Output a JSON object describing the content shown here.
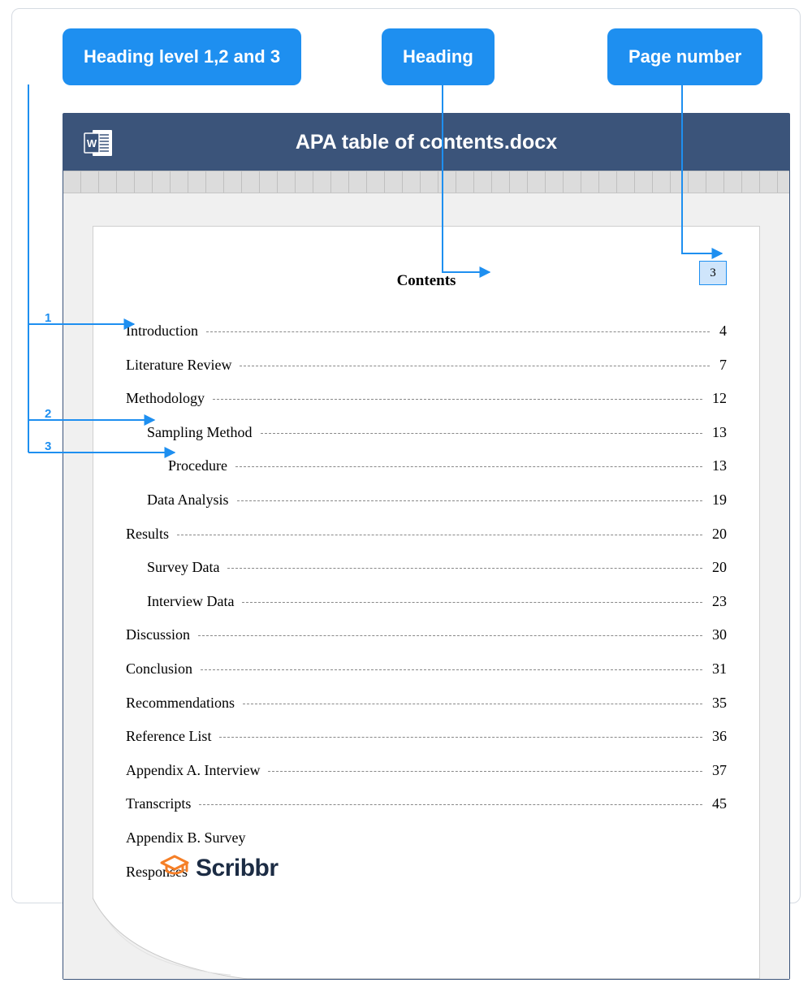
{
  "callouts": {
    "levels": "Heading level 1,2 and 3",
    "heading": "Heading",
    "pagenum": "Page number"
  },
  "levelNums": {
    "n1": "1",
    "n2": "2",
    "n3": "3"
  },
  "window": {
    "title": "APA table of contents.docx"
  },
  "page": {
    "number": "3",
    "contents_title": "Contents"
  },
  "toc": [
    {
      "label": "Introduction",
      "page": "4",
      "level": 1
    },
    {
      "label": "Literature Review",
      "page": "7",
      "level": 1
    },
    {
      "label": "Methodology",
      "page": "12",
      "level": 1
    },
    {
      "label": "Sampling Method",
      "page": "13",
      "level": 2
    },
    {
      "label": "Procedure",
      "page": "13",
      "level": 3
    },
    {
      "label": "Data Analysis",
      "page": "19",
      "level": 2
    },
    {
      "label": "Results",
      "page": "20",
      "level": 1
    },
    {
      "label": "Survey Data",
      "page": "20",
      "level": 2
    },
    {
      "label": "Interview Data",
      "page": "23",
      "level": 2
    },
    {
      "label": "Discussion",
      "page": "30",
      "level": 1
    },
    {
      "label": "Conclusion",
      "page": "31",
      "level": 1
    },
    {
      "label": "Recommendations",
      "page": "35",
      "level": 1
    },
    {
      "label": "Reference List",
      "page": "36",
      "level": 1
    },
    {
      "label": "Appendix A. Interview",
      "page": "37",
      "level": 1
    },
    {
      "label": "Transcripts",
      "page": "45",
      "level": 1
    },
    {
      "label": "Appendix B. Survey",
      "page": "",
      "level": 1
    },
    {
      "label": "Responses",
      "page": "",
      "level": 1
    }
  ],
  "brand": {
    "name": "Scribbr"
  }
}
